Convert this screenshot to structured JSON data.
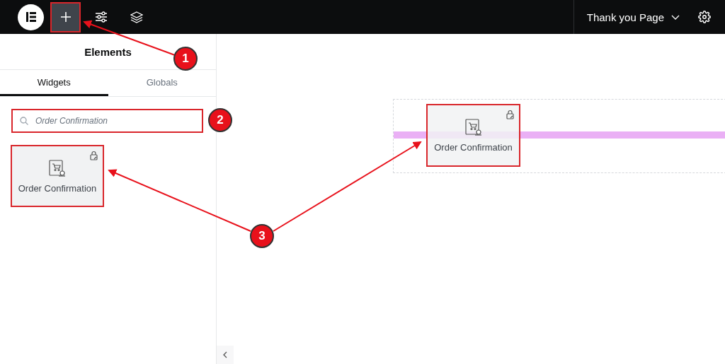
{
  "topbar": {
    "tools": [
      {
        "kind": "add",
        "selected": true
      },
      {
        "kind": "settings",
        "selected": false
      },
      {
        "kind": "layers",
        "selected": false
      }
    ],
    "page_title": "Thank you Page"
  },
  "panel": {
    "title": "Elements",
    "tabs": [
      {
        "label": "Widgets",
        "selected": true
      },
      {
        "label": "Globals",
        "selected": false
      }
    ],
    "search": {
      "placeholder": "Order Confirmation"
    },
    "widgets": [
      {
        "label": "Order Confirmation",
        "locked": true
      }
    ]
  },
  "canvas": {
    "dragged_widget": {
      "label": "Order Confirmation",
      "locked": true
    }
  },
  "annotations": [
    {
      "number": "1"
    },
    {
      "number": "2"
    },
    {
      "number": "3"
    }
  ]
}
